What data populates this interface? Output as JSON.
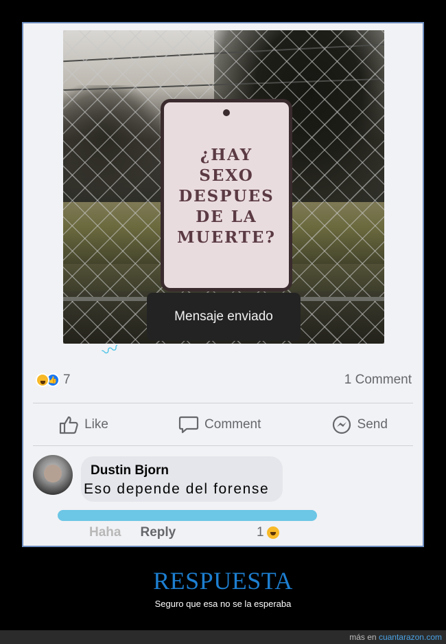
{
  "post": {
    "sign_lines": [
      "¿HAY",
      "SEXO",
      "DESPUES",
      "DE LA",
      "MUERTE?"
    ],
    "toast": "Mensaje enviado",
    "reactions_count": "7",
    "comment_count": "1 Comment"
  },
  "actions": {
    "like": "Like",
    "comment": "Comment",
    "send": "Send"
  },
  "comment": {
    "author": "Dustin Bjorn",
    "text": "Eso depende del forense",
    "haha": "Haha",
    "reply": "Reply",
    "reaction_count": "1"
  },
  "caption": {
    "title": "RESPUESTA",
    "subtitle": "Seguro que esa no se la esperaba"
  },
  "footer": {
    "prefix": "más en",
    "site": "cuantarazon.com"
  },
  "colors": {
    "title": "#1d7fd1",
    "facebook_blue": "#1877f2",
    "highlight": "#6cc6e6"
  }
}
